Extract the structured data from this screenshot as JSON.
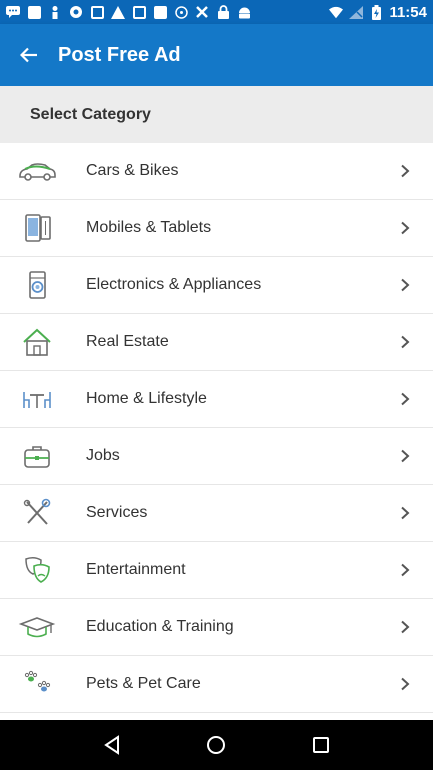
{
  "status_bar": {
    "time": "11:54",
    "icons": [
      "chat-icon",
      "flipboard-icon",
      "person-icon",
      "game-icon",
      "photo-icon",
      "alert-icon",
      "photo-icon",
      "flipboard-icon",
      "settings-icon",
      "tools-icon",
      "lock-icon",
      "android-icon",
      "wifi-icon",
      "signal-icon",
      "battery-icon"
    ]
  },
  "app_bar": {
    "title": "Post Free Ad"
  },
  "section": {
    "title": "Select Category"
  },
  "categories": [
    {
      "label": "Cars & Bikes",
      "icon": "car-icon"
    },
    {
      "label": "Mobiles & Tablets",
      "icon": "mobile-tablet-icon"
    },
    {
      "label": "Electronics & Appliances",
      "icon": "washing-machine-icon"
    },
    {
      "label": "Real Estate",
      "icon": "house-icon"
    },
    {
      "label": "Home & Lifestyle",
      "icon": "furniture-icon"
    },
    {
      "label": "Jobs",
      "icon": "briefcase-icon"
    },
    {
      "label": "Services",
      "icon": "tools-icon"
    },
    {
      "label": "Entertainment",
      "icon": "theater-masks-icon"
    },
    {
      "label": "Education & Training",
      "icon": "graduation-cap-icon"
    },
    {
      "label": "Pets & Pet Care",
      "icon": "paw-prints-icon"
    }
  ],
  "colors": {
    "status_bar": "#0b67b7",
    "app_bar": "#1478c8",
    "section_bg": "#ececec",
    "icon_accent": "#4caf50",
    "icon_blue": "#5b8fc9"
  }
}
